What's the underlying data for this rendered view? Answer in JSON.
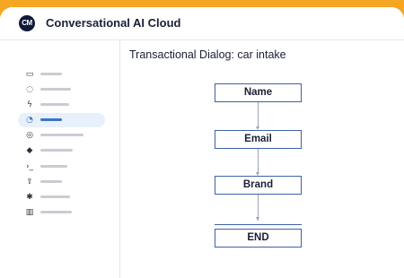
{
  "app": {
    "logo_text": "CM",
    "title": "Conversational AI Cloud"
  },
  "sidebar": {
    "items": [
      {
        "icon": "inbox-icon",
        "glyph": "▭",
        "active": false
      },
      {
        "icon": "chat-bubble-icon",
        "glyph": "◌",
        "active": false
      },
      {
        "icon": "lightning-icon",
        "glyph": "ϟ",
        "active": false
      },
      {
        "icon": "conversation-icon",
        "glyph": "◔",
        "active": true
      },
      {
        "icon": "target-icon",
        "glyph": "◎",
        "active": false
      },
      {
        "icon": "tag-icon",
        "glyph": "◆",
        "active": false
      },
      {
        "icon": "terminal-icon",
        "glyph": "›_",
        "active": false
      },
      {
        "icon": "upload-icon",
        "glyph": "⇪",
        "active": false
      },
      {
        "icon": "settings-icon",
        "glyph": "✱",
        "active": false
      },
      {
        "icon": "bar-chart-icon",
        "glyph": "▥",
        "active": false
      }
    ]
  },
  "main": {
    "title": "Transactional Dialog: car intake",
    "flow_nodes": [
      "Name",
      "Email",
      "Brand",
      "END"
    ]
  },
  "colors": {
    "accent_orange": "#f5a623",
    "node_border": "#3d62a8",
    "active_nav": "#3b73c8"
  }
}
